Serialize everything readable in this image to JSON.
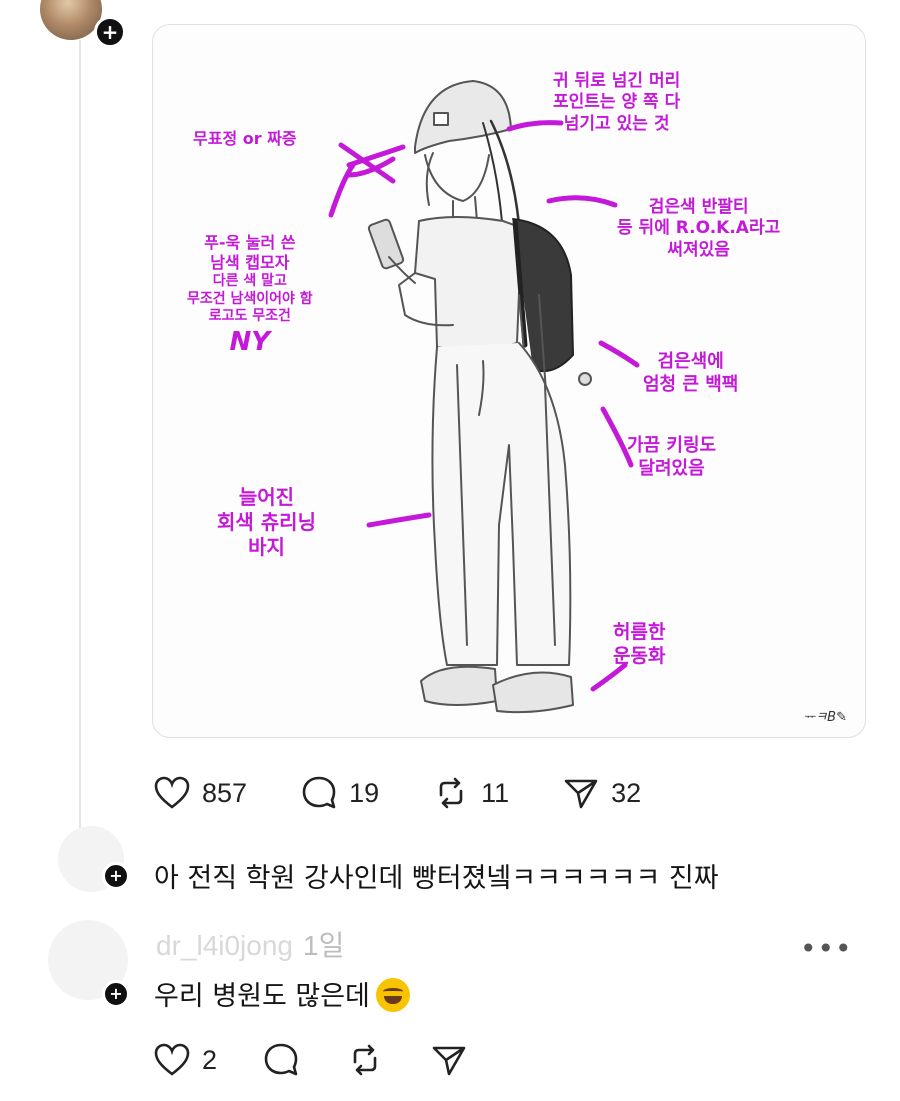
{
  "post": {
    "annotations": {
      "cap_style": "무표정 or 짜증",
      "hair": [
        "귀 뒤로 넘긴 머리",
        "포인트는 양 쪽 다",
        "넘기고 있는 것"
      ],
      "cap": [
        "푸-욱 눌러 쓴",
        "남색 캡모자",
        "다른 색 말고",
        "무조건 남색이어야 함",
        "로고도 무조건"
      ],
      "logo": "NY",
      "tshirt": [
        "검은색 반팔티",
        "등 뒤에 R.O.K.A라고",
        "써져있음"
      ],
      "backpack": [
        "검은색에",
        "엄청 큰 백팩"
      ],
      "keyring": [
        "가끔 키링도",
        "달려있음"
      ],
      "pants": [
        "늘어진",
        "회색 츄리닝",
        "바지"
      ],
      "shoes": [
        "허름한",
        "운동화"
      ]
    },
    "signature": "ᅲㅋB✎",
    "likes": "857",
    "comments": "19",
    "reposts": "11",
    "shares": "32"
  },
  "replies": [
    {
      "text": "아 전직 학원 강사인데 빵터졌넼ㅋㅋㅋㅋㅋㅋ 진짜"
    },
    {
      "username": "dr_l4i0jong",
      "time": "1일",
      "text": "우리 병원도 많은데",
      "likes": "2"
    }
  ],
  "colors": {
    "annotation": "#c419d8",
    "text": "#151515",
    "muted": "#bdbdbd"
  }
}
